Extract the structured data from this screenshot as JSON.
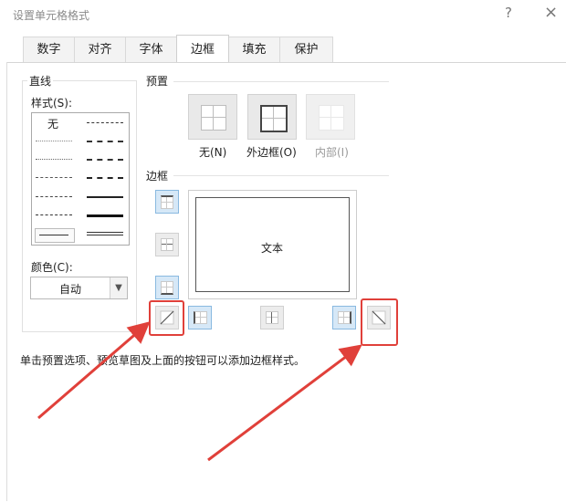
{
  "window": {
    "title": "设置单元格格式",
    "help_label": "?",
    "close_label": "×"
  },
  "tabs": [
    "数字",
    "对齐",
    "字体",
    "边框",
    "填充",
    "保护"
  ],
  "active_tab_index": 3,
  "line_group": {
    "heading": "直线",
    "style_label": "样式(S):",
    "none_label": "无",
    "color_label": "颜色(C):",
    "color_value": "自动"
  },
  "presets": {
    "heading": "预置",
    "items": [
      {
        "label": "无(N)",
        "enabled": true
      },
      {
        "label": "外边框(O)",
        "enabled": true
      },
      {
        "label": "内部(I)",
        "enabled": false
      }
    ]
  },
  "border_group": {
    "heading": "边框",
    "preview_text": "文本"
  },
  "hint_text": "单击预置选项、预览草图及上面的按钮可以添加边框样式。",
  "colors": {
    "annotation": "#e0403a",
    "pressed": "#d6e8f7"
  }
}
